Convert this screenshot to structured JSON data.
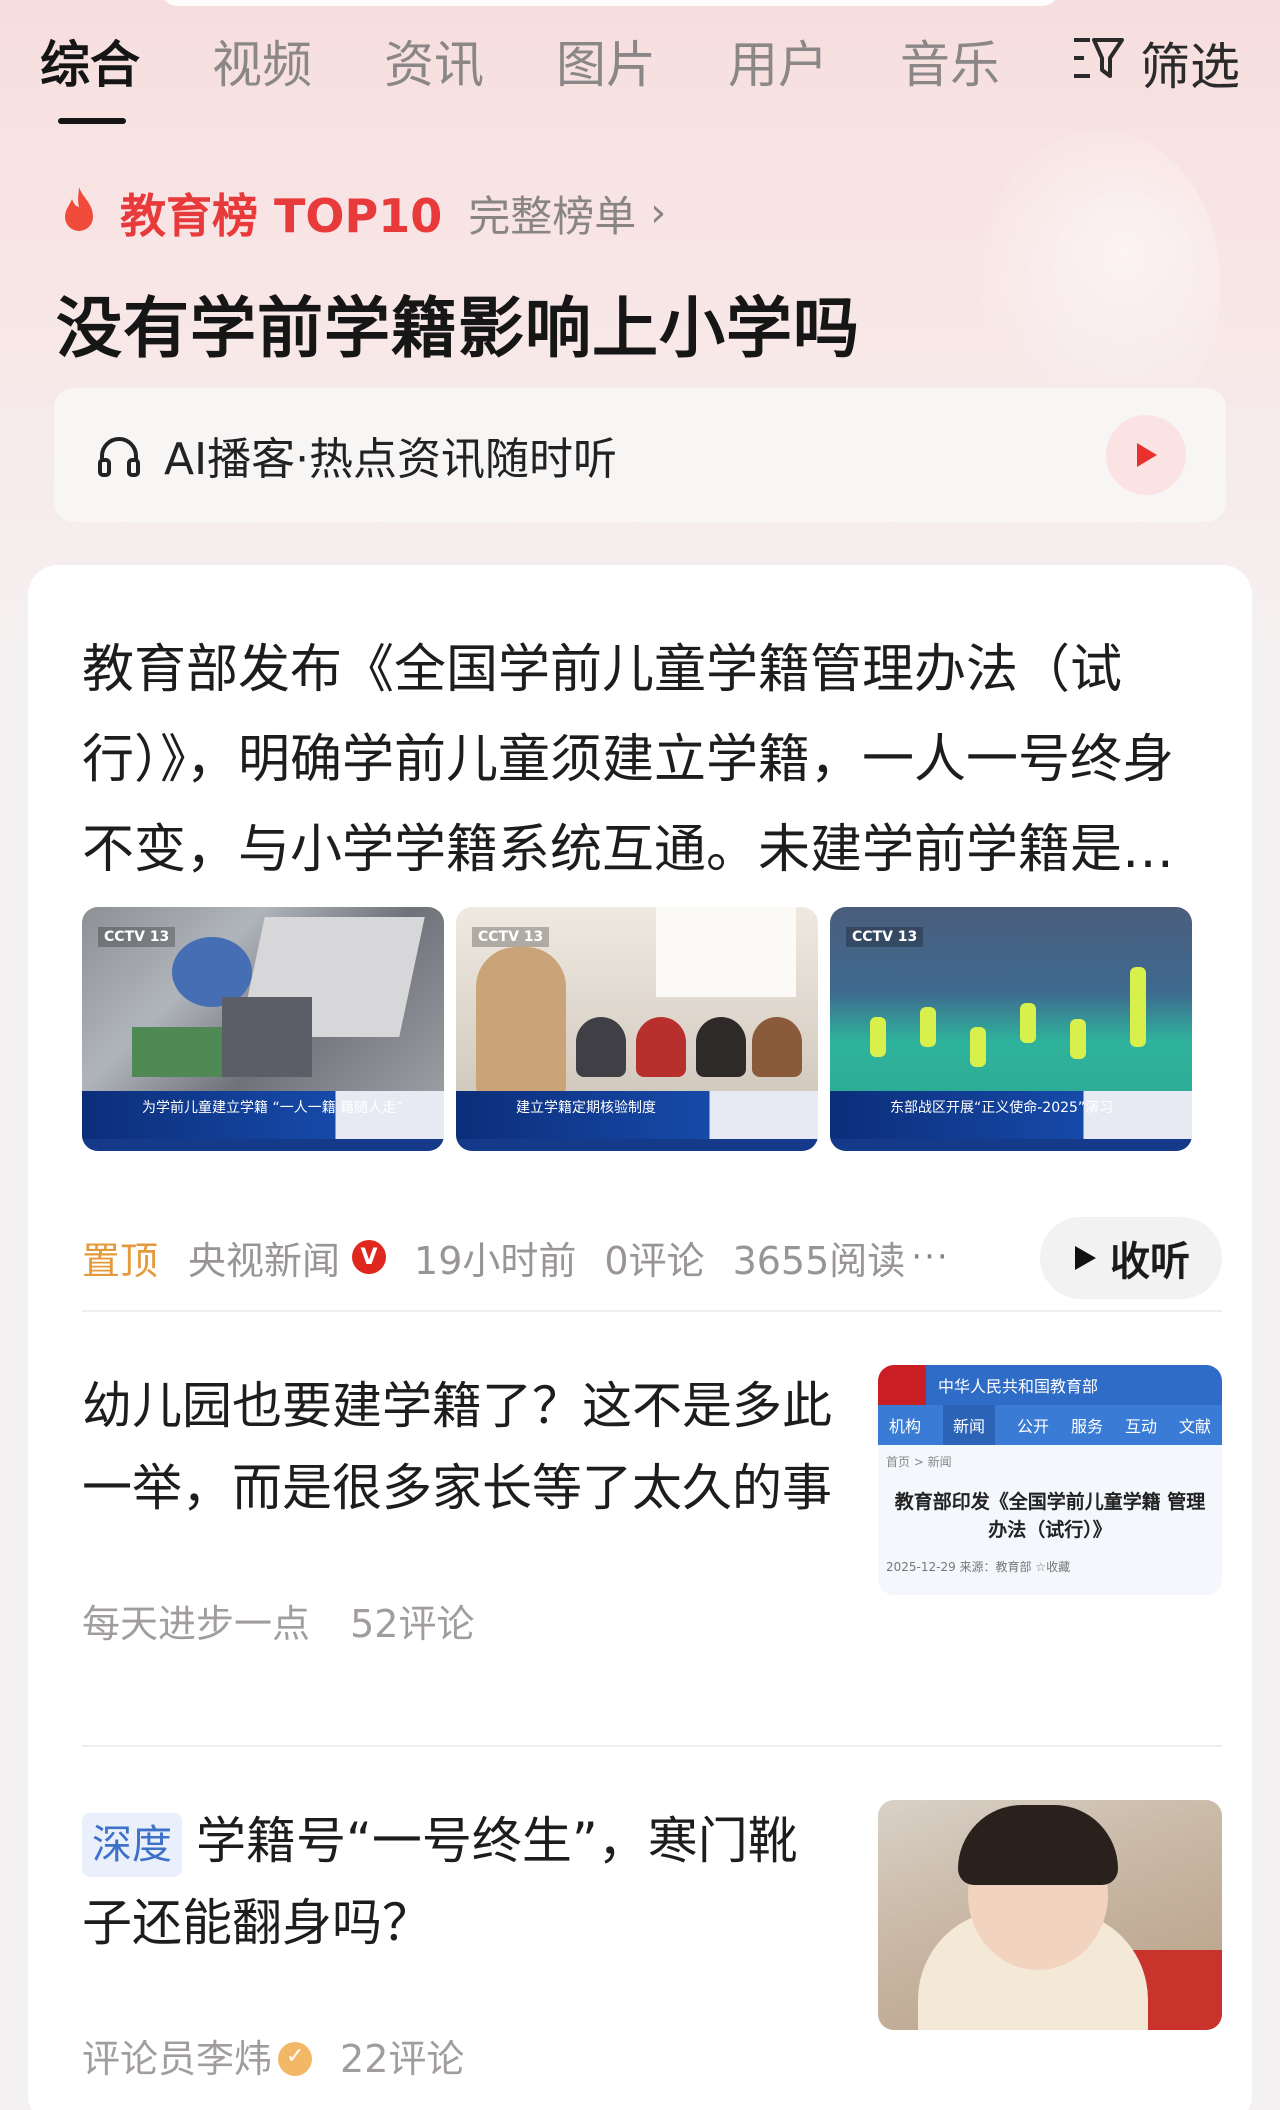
{
  "tabs": [
    {
      "label": "综合",
      "active": true
    },
    {
      "label": "视频"
    },
    {
      "label": "资讯"
    },
    {
      "label": "图片"
    },
    {
      "label": "用户"
    },
    {
      "label": "音乐"
    }
  ],
  "filter_label": "筛选",
  "hot_board": {
    "label": "教育榜 TOP10",
    "full_list": "完整榜单",
    "topic": "没有学前学籍影响上小学吗"
  },
  "podcast": {
    "text": "AI播客·热点资讯随时听"
  },
  "lead_article": {
    "title": "教育部发布《全国学前儿童学籍管理办法（试行）》，明确学前儿童须建立学籍，一人一号终身不变，与小学学籍系统互通。未建学前学籍是否影响上小学，各地将有具体衔接办法。",
    "images": [
      {
        "caption": "为学前儿童建立学籍 “一人一籍 籍随人走”",
        "logo": "CCTV 13"
      },
      {
        "caption": "建立学籍定期核验制度",
        "logo": "CCTV 13"
      },
      {
        "caption": "东部战区开展“正义使命-2025”演习",
        "logo": "CCTV 13"
      }
    ],
    "pinned": "置顶",
    "source": "央视新闻",
    "source_badge": "V",
    "time": "19小时前",
    "comments": "0评论",
    "reads": "3655阅读",
    "more": "···",
    "listen": "收听"
  },
  "articles": [
    {
      "title": "幼儿园也要建学籍了？这不是多此一举，而是很多家长等了太久的事",
      "author": "每天进步一点",
      "comments": "52评论",
      "image": {
        "header": "中华人民共和国教育部",
        "nav": [
          "机构",
          "新闻",
          "公开",
          "服务",
          "互动",
          "文献"
        ],
        "crumb": "首页 > 新闻",
        "title": "教育部印发《全国学前儿童学籍 管理办法（试行）》",
        "footer": "2025-12-29  来源：教育部  ☆收藏"
      }
    },
    {
      "tag": "深度",
      "title": "学籍号“一号终生”，寒门靴子还能翻身吗？",
      "author": "评论员李炜",
      "comments": "22评论"
    }
  ],
  "colors": {
    "accent_red": "#e83a3a",
    "pin_orange": "#e49a3a",
    "deep_blue": "#3e71c8"
  }
}
